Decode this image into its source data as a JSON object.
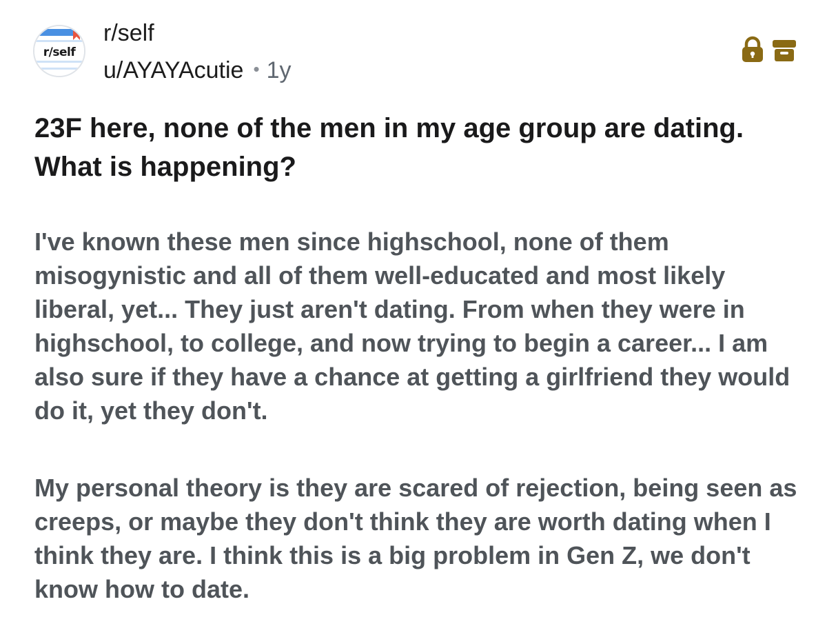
{
  "post": {
    "subreddit_avatar_text": "r/self",
    "subreddit": "r/self",
    "author": "u/AYAYAcutie",
    "separator": "•",
    "age": "1y",
    "title": "23F here, none of the men in my age group are dating. What is happening?",
    "paragraphs": [
      "I've known these men since highschool, none of them misogynistic and all of them well-educated and most likely liberal, yet... They just aren't dating. From when they were in highschool, to college, and now trying to begin a career... I am also sure if they have a chance at getting a girlfriend they would do it, yet they don't.",
      "My personal theory is they are scared of rejection, being seen as creeps, or maybe they don't think they are worth dating when I think they are. I think this is a big problem in Gen Z, we don't know how to date."
    ]
  },
  "icons": {
    "lock": "lock-icon",
    "archive": "archive-icon"
  },
  "colors": {
    "status_icon": "#8a6a14",
    "title_text": "#1a1a1b",
    "body_text": "#4f5459",
    "meta_muted": "#5f6770"
  }
}
